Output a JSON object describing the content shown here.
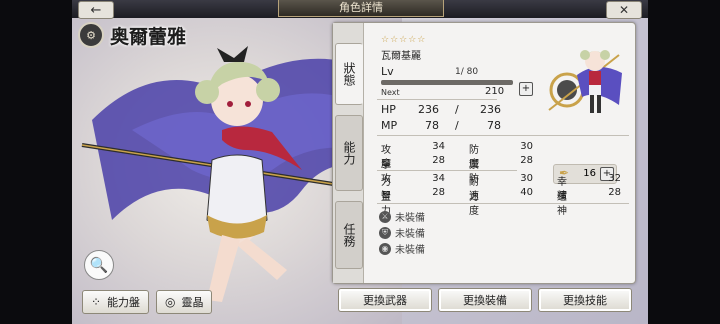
{
  "header": {
    "title": "角色詳情",
    "back_icon": "←",
    "close_icon": "✕"
  },
  "character": {
    "display_name": "奥爾蕾雅",
    "emblem_icon": "⚙",
    "stars": "☆☆☆☆☆",
    "name": "瓦爾基麗",
    "lv_label": "Lv",
    "level": "1/ 80",
    "exp_fraction": 0.0,
    "next_label": "Next",
    "next_value": "210",
    "hp_label": "HP",
    "hp_current": "236",
    "hp_sep": "/",
    "hp_max": "236",
    "mp_label": "MP",
    "mp_current": "78",
    "mp_sep": "/",
    "mp_max": "78"
  },
  "tabs": [
    {
      "label": "狀態"
    },
    {
      "label": "能力"
    },
    {
      "label": "任務"
    }
  ],
  "stats": [
    {
      "l1": "攻擊",
      "v1": "34",
      "l2": "防禦",
      "v2": "30"
    },
    {
      "l1": "魔攻",
      "v1": "28",
      "l2": "魔防",
      "v2": "28"
    },
    {
      "l1": "力量",
      "v1": "34",
      "l2": "耐力",
      "v2": "30",
      "l3": "幸運",
      "v3": "32"
    },
    {
      "l1": "智力",
      "v1": "28",
      "l2": "速度",
      "v2": "40",
      "l3": "精神",
      "v3": "28"
    }
  ],
  "feather": {
    "icon": "✒",
    "value": "16"
  },
  "plus_label": "+",
  "equipment": [
    {
      "icon": "⚔",
      "label": "未裝備"
    },
    {
      "icon": "⛨",
      "label": "未裝備"
    },
    {
      "icon": "◉",
      "label": "未裝備"
    }
  ],
  "bottom_left": {
    "zoom_icon": "🔍",
    "ability_board_icon": "⁘",
    "ability_board_label": "能力盤",
    "spirit_icon": "◎",
    "spirit_label": "靈晶"
  },
  "actions": {
    "weapon": "更換武器",
    "gear": "更換裝備",
    "skill": "更換技能"
  }
}
